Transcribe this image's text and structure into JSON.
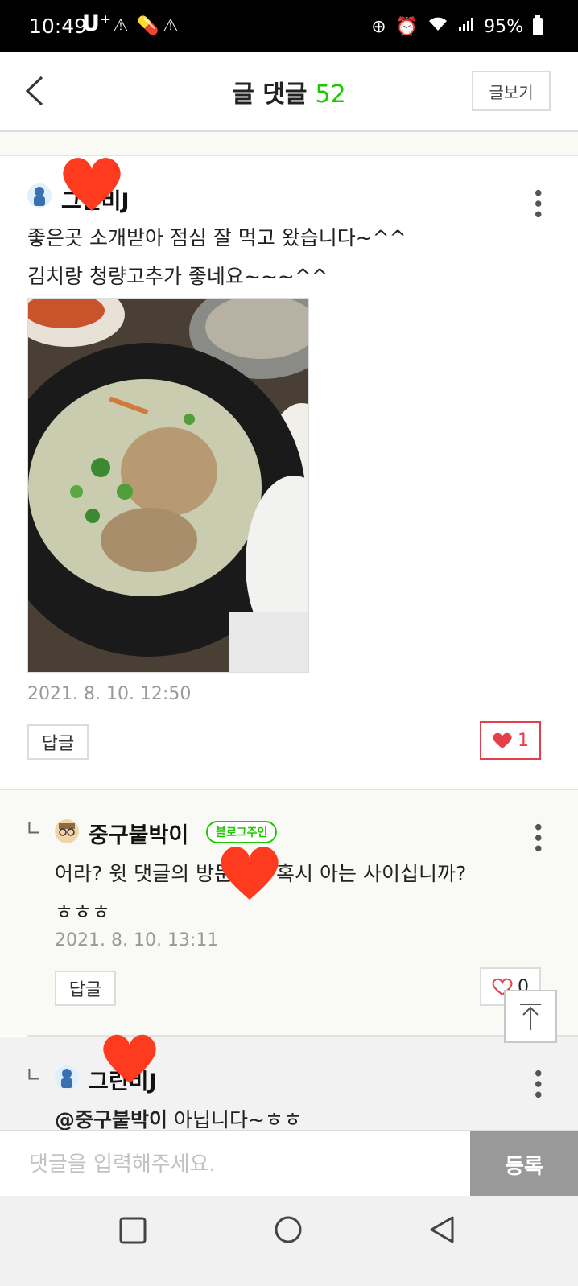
{
  "status_bar": {
    "time": "10:49",
    "carrier": "U⁺",
    "battery": "95%"
  },
  "header": {
    "title": "글 댓글",
    "count": "52",
    "view_post_label": "글보기"
  },
  "comments": [
    {
      "nickname": "그린비J",
      "lines": [
        "좋은곳 소개받아 점심 잘 먹고 왔습니다~^^",
        "김치랑 청량고추가 좋네요~~~^^"
      ],
      "date": "2021. 8. 10. 12:50",
      "reply_label": "답글",
      "likes": "1"
    },
    {
      "nickname": "중구붙박이",
      "badge": "블로그주인",
      "lines": [
        "어라? 윗 댓글의 방문하고 혹시 아는 사이십니까?",
        "ㅎㅎㅎ"
      ],
      "date": "2021. 8. 10. 13:11",
      "reply_label": "답글",
      "likes": "0"
    },
    {
      "nickname": "그린비J",
      "mention": "@중구붙박이",
      "text": "아닙니다~ㅎㅎ"
    }
  ],
  "input": {
    "placeholder": "댓글을 입력해주세요.",
    "submit_label": "등록"
  },
  "colors": {
    "accent_green": "#1ec800",
    "like_red": "#e5404a",
    "heart_sticker": "#ff3b1f"
  }
}
